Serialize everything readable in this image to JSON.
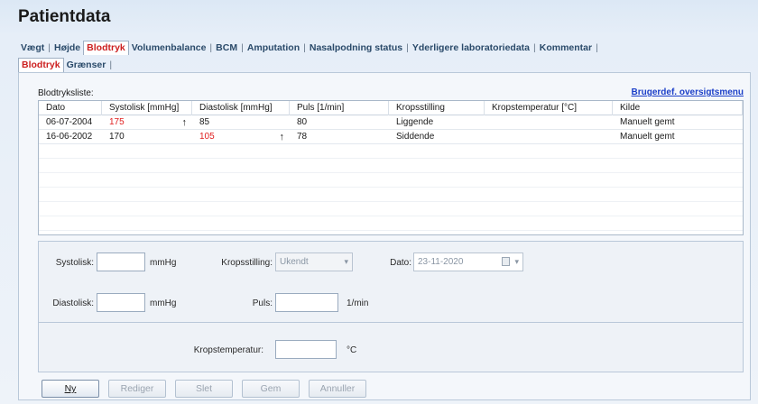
{
  "page_title": "Patientdata",
  "tabs": [
    {
      "label": "Vægt",
      "active": false
    },
    {
      "label": "Højde",
      "active": false
    },
    {
      "label": "Blodtryk",
      "active": true
    },
    {
      "label": "Volumenbalance",
      "active": false
    },
    {
      "label": "BCM",
      "active": false
    },
    {
      "label": "Amputation",
      "active": false
    },
    {
      "label": "Nasalpodning status",
      "active": false
    },
    {
      "label": "Yderligere laboratoriedata",
      "active": false
    },
    {
      "label": "Kommentar",
      "active": false
    }
  ],
  "subtabs": [
    {
      "label": "Blodtryk",
      "active": true
    },
    {
      "label": "Grænser",
      "active": false
    }
  ],
  "list": {
    "label": "Blodtryksliste:",
    "menu_link": "Brugerdef. oversigtsmenu",
    "columns": [
      "Dato",
      "Systolisk [mmHg]",
      "Diastolisk [mmHg]",
      "Puls [1/min]",
      "Kropsstilling",
      "Kropstemperatur [°C]",
      "Kilde"
    ],
    "rows": [
      {
        "dato": "06-07-2004",
        "systolisk": "175",
        "diastolisk": "85",
        "puls": "80",
        "kropsstilling": "Liggende",
        "temp": "",
        "kilde": "Manuelt gemt"
      },
      {
        "dato": "16-06-2002",
        "systolisk": "170",
        "diastolisk": "105",
        "puls": "78",
        "kropsstilling": "Siddende",
        "temp": "",
        "kilde": "Manuelt gemt"
      }
    ],
    "arrow_glyph": "↑"
  },
  "form": {
    "systolisk_label": "Systolisk:",
    "systolisk_value": "",
    "diastolisk_label": "Diastolisk:",
    "diastolisk_value": "",
    "unit_mmhg": "mmHg",
    "kropsstilling_label": "Kropsstilling:",
    "kropsstilling_value": "Ukendt",
    "puls_label": "Puls:",
    "puls_value": "",
    "unit_puls": "1/min",
    "dato_label": "Dato:",
    "dato_value": "23-11-2020",
    "kropstemp_label": "Kropstemperatur:",
    "kropstemp_value": "",
    "unit_temp": "°C"
  },
  "buttons": {
    "ny": "Ny",
    "rediger": "Rediger",
    "slet": "Slet",
    "gem": "Gem",
    "annuller": "Annuller"
  },
  "colors": {
    "active_tab": "#cc1f1f",
    "elevated_value": "#e01e1e",
    "link": "#1a3ec8"
  }
}
